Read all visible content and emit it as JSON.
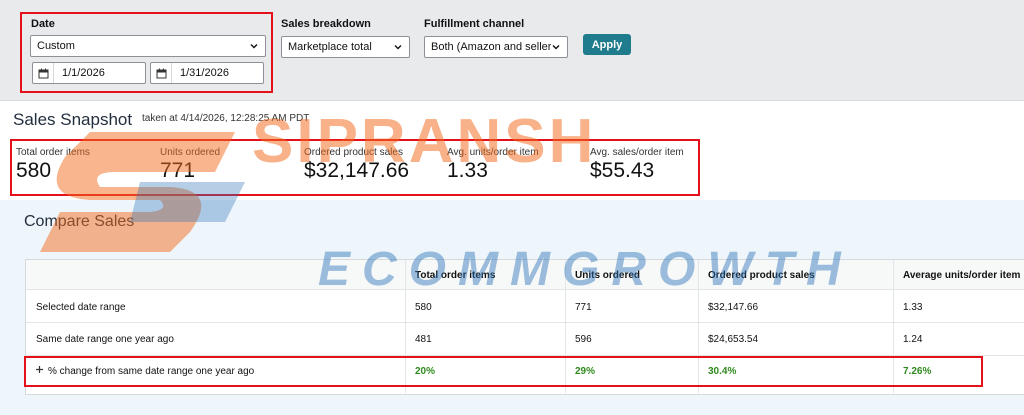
{
  "filters": {
    "date": {
      "label": "Date",
      "selected": "Custom",
      "start": "1/1/2026",
      "end": "1/31/2026"
    },
    "sales_breakdown": {
      "label": "Sales breakdown",
      "selected": "Marketplace total"
    },
    "fulfillment": {
      "label": "Fulfillment channel",
      "selected": "Both (Amazon and seller)"
    },
    "apply_label": "Apply"
  },
  "snapshot": {
    "title": "Sales Snapshot",
    "taken_at": "taken at 4/14/2026, 12:28:25 AM PDT",
    "metrics": [
      {
        "label": "Total order items",
        "value": "580"
      },
      {
        "label": "Units ordered",
        "value": "771"
      },
      {
        "label": "Ordered product sales",
        "value": "$32,147.66"
      },
      {
        "label": "Avg. units/order item",
        "value": "1.33"
      },
      {
        "label": "Avg. sales/order item",
        "value": "$55.43"
      }
    ]
  },
  "compare": {
    "title": "Compare Sales",
    "columns": [
      "Total order items",
      "Units ordered",
      "Ordered product sales",
      "Average units/order item"
    ],
    "rows": [
      {
        "label": "Selected date range",
        "values": [
          "580",
          "771",
          "$32,147.66",
          "1.33"
        ]
      },
      {
        "label": "Same date range one year ago",
        "values": [
          "481",
          "596",
          "$24,653.54",
          "1.24"
        ]
      },
      {
        "label": "% change from same date range one year ago",
        "values": [
          "20%",
          "29%",
          "30.4%",
          "7.26%"
        ]
      }
    ]
  },
  "watermark": {
    "line1": "SIPRANSH",
    "line2": "ECOMMGROWTH"
  },
  "colors": {
    "highlight": "#e4111b",
    "apply": "#1f7c8c",
    "positive": "#2f8a1e",
    "watermark_orange": "#f26b1d",
    "watermark_blue": "#2b73b8"
  },
  "icons": {
    "dropdown": "chevron-down-icon",
    "calendar": "calendar-icon",
    "expand": "plus-icon"
  }
}
